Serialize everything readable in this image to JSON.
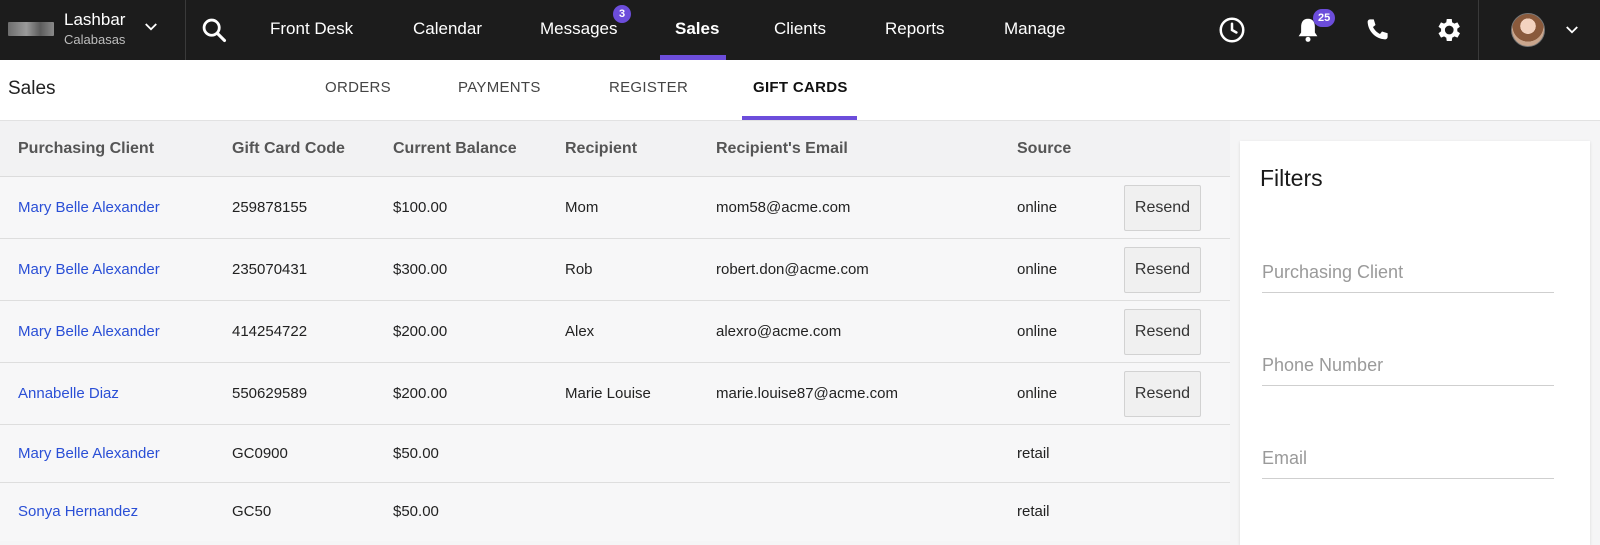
{
  "brand": {
    "name": "Lashbar",
    "location": "Calabasas"
  },
  "nav": {
    "items": [
      {
        "label": "Front Desk"
      },
      {
        "label": "Calendar"
      },
      {
        "label": "Messages",
        "badge": "3"
      },
      {
        "label": "Sales",
        "active": true
      },
      {
        "label": "Clients"
      },
      {
        "label": "Reports"
      },
      {
        "label": "Manage"
      }
    ],
    "icons": [
      "search-icon",
      "clock-icon",
      "bell-icon",
      "phone-icon",
      "gear-icon",
      "avatar",
      "chevron-down-icon"
    ],
    "notifications_badge": "25",
    "accent_color": "#6c4ddb"
  },
  "subheader": {
    "title": "Sales",
    "tabs": [
      {
        "label": "ORDERS"
      },
      {
        "label": "PAYMENTS"
      },
      {
        "label": "REGISTER"
      },
      {
        "label": "GIFT CARDS",
        "active": true
      }
    ]
  },
  "table": {
    "headers": [
      "Purchasing Client",
      "Gift Card Code",
      "Current Balance",
      "Recipient",
      "Recipient's Email",
      "Source"
    ],
    "resend_label": "Resend",
    "rows": [
      {
        "client": "Mary Belle Alexander",
        "code": "259878155",
        "balance": "$100.00",
        "recipient": "Mom",
        "email": "mom58@acme.com",
        "source": "online",
        "resend": true
      },
      {
        "client": "Mary Belle Alexander",
        "code": "235070431",
        "balance": "$300.00",
        "recipient": "Rob",
        "email": "robert.don@acme.com",
        "source": "online",
        "resend": true
      },
      {
        "client": "Mary Belle Alexander",
        "code": "414254722",
        "balance": "$200.00",
        "recipient": "Alex",
        "email": "alexro@acme.com",
        "source": "online",
        "resend": true
      },
      {
        "client": "Annabelle Diaz",
        "code": "550629589",
        "balance": "$200.00",
        "recipient": "Marie Louise",
        "email": "marie.louise87@acme.com",
        "source": "online",
        "resend": true
      },
      {
        "client": "Mary Belle Alexander",
        "code": "GC0900",
        "balance": "$50.00",
        "recipient": "",
        "email": "",
        "source": "retail",
        "resend": false
      },
      {
        "client": "Sonya Hernandez",
        "code": "GC50",
        "balance": "$50.00",
        "recipient": "",
        "email": "",
        "source": "retail",
        "resend": false
      }
    ]
  },
  "filters": {
    "title": "Filters",
    "fields": [
      {
        "placeholder": "Purchasing Client",
        "value": ""
      },
      {
        "placeholder": "Phone Number",
        "value": ""
      },
      {
        "placeholder": "Email",
        "value": ""
      }
    ]
  }
}
